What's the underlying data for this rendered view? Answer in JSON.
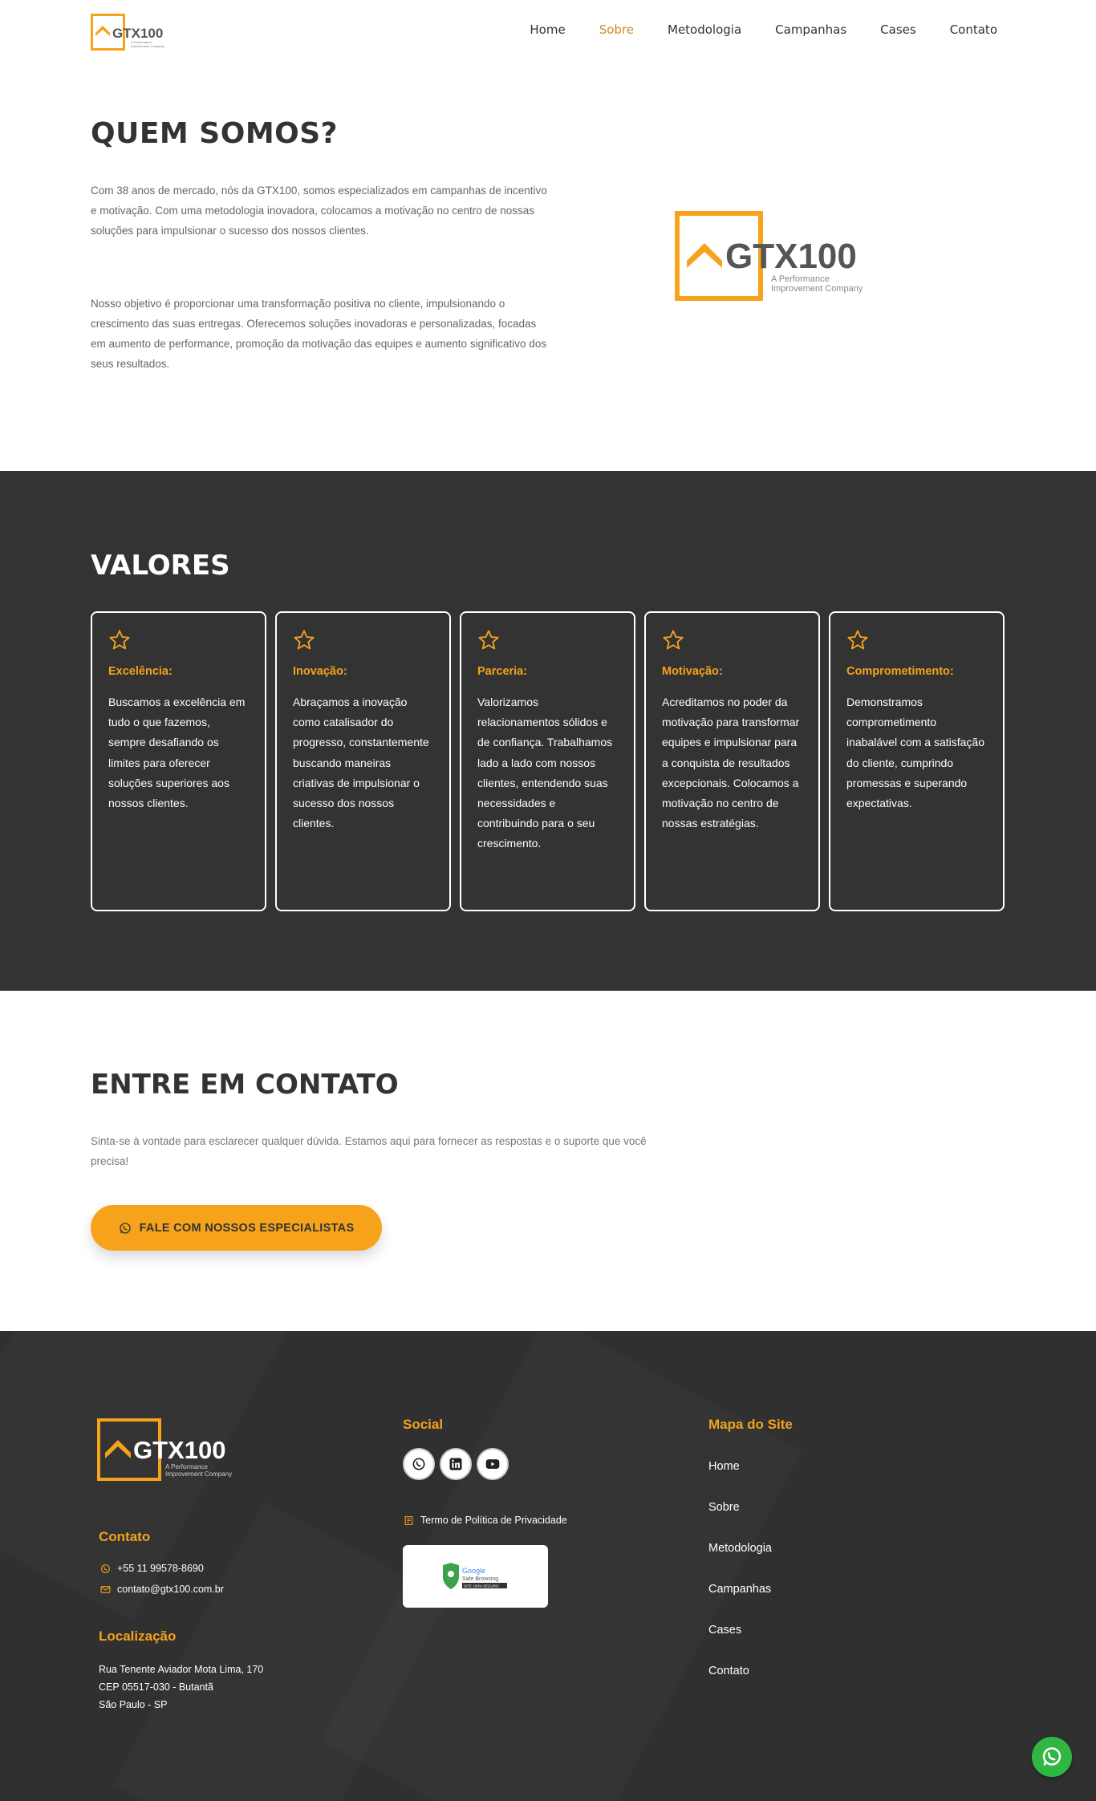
{
  "brand": {
    "name": "GTX100",
    "tagline": "A Performance Improvement Company"
  },
  "nav": {
    "items": [
      "Home",
      "Sobre",
      "Metodologia",
      "Campanhas",
      "Cases",
      "Contato"
    ],
    "active": "Sobre"
  },
  "about": {
    "title": "QUEM SOMOS?",
    "p1": "Com 38 anos de mercado, nós da GTX100, somos especializados em campanhas de incentivo e motivação. Com uma metodologia inovadora, colocamos a motivação no centro de nossas soluções para impulsionar o sucesso dos nossos clientes.",
    "p2": "Nosso objetivo é proporcionar uma transformação positiva no cliente, impulsionando o crescimento das suas entregas. Oferecemos soluções inovadoras e personalizadas, focadas em aumento de performance, promoção da motivação das equipes e aumento significativo dos seus resultados."
  },
  "valores": {
    "title": "VALORES",
    "cards": [
      {
        "title": "Excelência:",
        "text": "Buscamos a excelência em tudo o que fazemos, sempre desafiando os limites para oferecer soluções superiores aos nossos clientes."
      },
      {
        "title": "Inovação:",
        "text": "Abraçamos a inovação como catalisador do progresso, constantemente buscando maneiras criativas de impulsionar o sucesso dos nossos clientes."
      },
      {
        "title": "Parceria:",
        "text": "Valorizamos relacionamentos sólidos e de confiança. Trabalhamos lado a lado com nossos clientes, entendendo suas necessidades e contribuindo para o seu crescimento."
      },
      {
        "title": "Motivação:",
        "text": "Acreditamos no poder da motivação para transformar equipes e impulsionar para a conquista de resultados excepcionais. Colocamos a motivação no centro de nossas estratégias."
      },
      {
        "title": "Comprometimento:",
        "text": "Demonstramos comprometimento inabalável com a satisfação do cliente, cumprindo promessas e superando expectativas."
      }
    ]
  },
  "contact": {
    "title": "ENTRE EM CONTATO",
    "text": "Sinta-se à vontade para esclarecer qualquer dúvida. Estamos aqui para fornecer as respostas e o suporte que você precisa!",
    "cta": "FALE COM NOSSOS ESPECIALISTAS"
  },
  "footer": {
    "contato_title": "Contato",
    "phone": "+55 11 99578-8690",
    "email": "contato@gtx100.com.br",
    "localizacao_title": "Localização",
    "address1": "Rua Tenente Aviador Mota Lima, 170",
    "address2": "CEP 05517-030 - Butantã",
    "address3": "São Paulo - SP",
    "social_title": "Social",
    "privacy": "Termo de Política de Privacidade",
    "badge_line1": "Google",
    "badge_line2": "Safe Browsing",
    "badge_line3": "SITE 100% SEGURO",
    "sitemap_title": "Mapa do Site",
    "sitemap": [
      "Home",
      "Sobre",
      "Metodologia",
      "Campanhas",
      "Cases",
      "Contato"
    ]
  },
  "colors": {
    "accent": "#f7a21b",
    "dark": "#333333",
    "whatsapp": "#2fb742"
  }
}
